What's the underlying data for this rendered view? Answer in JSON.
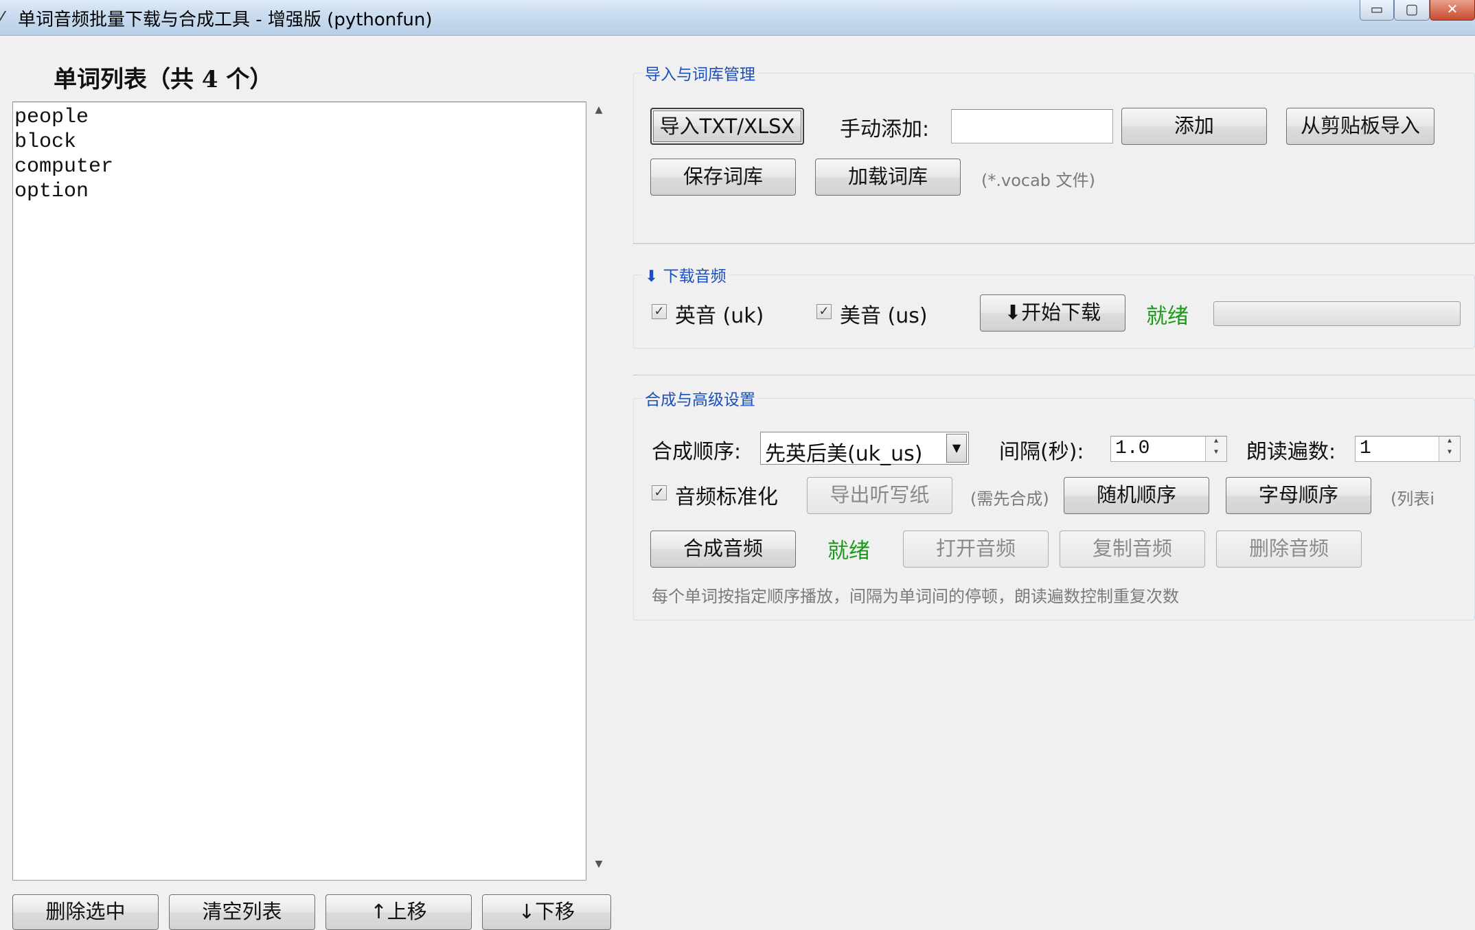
{
  "window": {
    "title": "单词音频批量下载与合成工具 - 增强版 (pythonfun)",
    "icon": "app-icon",
    "minimize": "▭",
    "maximize": "▢",
    "close": "✕"
  },
  "left": {
    "list_title": "单词列表（共 4 个）",
    "words": [
      "people",
      "block",
      "computer",
      "option"
    ],
    "buttons": {
      "delete_selected": "删除选中",
      "clear_list": "清空列表",
      "move_up": "↑上移",
      "move_down": "↓下移"
    }
  },
  "import_group": {
    "title": "导入与词库管理",
    "import_button": "导入TXT/XLSX",
    "manual_add_label": "手动添加:",
    "manual_add_value": "",
    "add_button": "添加",
    "clipboard_button": "从剪贴板导入",
    "save_button": "保存词库",
    "load_button": "加载词库",
    "vocab_hint": "(*.vocab 文件)"
  },
  "download_group": {
    "title": "⬇ 下载音频",
    "uk_label": "英音 (uk)",
    "uk_checked": true,
    "us_label": "美音 (us)",
    "us_checked": true,
    "start_button": "⬇开始下载",
    "status": "就绪",
    "progress": 0
  },
  "synth_group": {
    "title": "合成与高级设置",
    "order_label": "合成顺序:",
    "order_value": "先英后美(uk_us)",
    "interval_label": "间隔(秒):",
    "interval_value": "1.0",
    "repeat_label": "朗读遍数:",
    "repeat_value": "1",
    "normalize_label": "音频标准化",
    "normalize_checked": true,
    "export_dictation_button": "导出听写纸",
    "export_hint": "(需先合成)",
    "random_order_button": "随机顺序",
    "alpha_order_button": "字母顺序",
    "list_hint": "(列表i",
    "synth_button": "合成音频",
    "synth_status": "就绪",
    "open_audio_button": "打开音频",
    "copy_audio_button": "复制音频",
    "delete_audio_button": "删除音频",
    "help_text": "每个单词按指定顺序播放，间隔为单词间的停顿，朗读遍数控制重复次数"
  },
  "colors": {
    "status_green": "#1a9a1a",
    "group_title_blue": "#1a4fbd"
  }
}
